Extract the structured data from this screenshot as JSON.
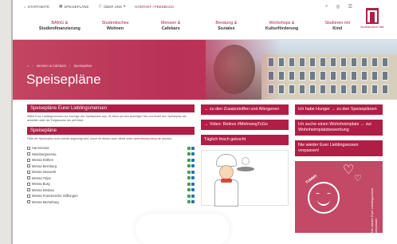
{
  "topbar": {
    "links": [
      "STARTSEITE",
      "SPEISEPLÄNE",
      "ÜBER UNS",
      "KONTAKT / FEEDBACK"
    ],
    "icons": [
      "search-icon",
      "instagram-icon",
      "menu-icon"
    ]
  },
  "logo": {
    "caption": "Studentenwerk Halle"
  },
  "nav": [
    {
      "l1": "BAföG &",
      "l2": "Studienfinanzierung"
    },
    {
      "l1": "Studentisches",
      "l2": "Wohnen"
    },
    {
      "l1": "Mensen &",
      "l2": "Cafebars"
    },
    {
      "l1": "Beratung &",
      "l2": "Soziales"
    },
    {
      "l1": "Workshops &",
      "l2": "Kulturförderung"
    },
    {
      "l1": "Studieren mit",
      "l2": "Kind"
    }
  ],
  "hero": {
    "breadcrumb": [
      "Mensen & Cafebars",
      "Speisepläne"
    ],
    "title": "Speisepläne"
  },
  "main": {
    "fav_heading": "Speisepläne Eurer Lieblingsmensen",
    "fav_text": "Wählt Eure Lieblingsmensen zur Anzeige des Speiseplans aus. Ihr klickt auf den jeweiligen Tab und findet den Speiseplan der aktuellen oder der Folgewoche als pdf-Datei.",
    "plans_heading": "Speisepläne",
    "plans_text_a": "Falls der Speiseplan nicht korrekt angezeigt wird, könnt ihr diesen auch direkt unter",
    "plans_text_link": "www.mensa-menu.de",
    "plans_text_b": "abrufen.",
    "mensen": [
      "Harzmensa",
      "Weinbergmensa",
      "Mensa Köthen",
      "Mensa Bernburg",
      "Mensa Neuwerk",
      "Mensa Tulpe",
      "Mensa Burg",
      "Mensa Dessau",
      "Mensa Franckesche Stiftungen",
      "Mensa Merseburg"
    ]
  },
  "mid": {
    "link1": "→ zu den Zusatzstoffen und Allergenen",
    "link2": "→ Video: Relevo #MehrwegToGo",
    "fresh_heading": "Täglich frisch gekocht"
  },
  "side": {
    "box1": "Ich habe Hunger → zu den Speiseplänen",
    "box2": "Ich suche einen Wohnheimplatz → zur Wohnheimplatzbewerbung",
    "box3": "Nie wieder Euer Lieblingsessen verpassen!",
    "promo_word": "YUMMY",
    "promo_side": "Nie wieder Euer Lieblingsessen verpassen"
  }
}
